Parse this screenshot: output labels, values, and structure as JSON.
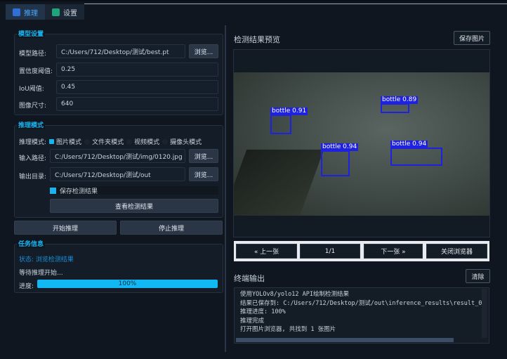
{
  "tabs": [
    {
      "label": "推理",
      "icon": "chart-icon"
    },
    {
      "label": "设置",
      "icon": "check-icon"
    }
  ],
  "model_settings": {
    "title": "模型设置",
    "path_label": "模型路径:",
    "path_value": "C:/Users/712/Desktop/测试/best.pt",
    "browse": "浏览...",
    "conf_label": "置信度阈值:",
    "conf_value": "0.25",
    "iou_label": "IoU阈值:",
    "iou_value": "0.45",
    "size_label": "图像尺寸:",
    "size_value": "640"
  },
  "inference_mode": {
    "title": "推理模式",
    "mode_label": "推理模式:",
    "modes": [
      "图片模式",
      "文件夹模式",
      "视频模式",
      "摄像头模式"
    ],
    "input_label": "输入路径:",
    "input_value": "C:/Users/712/Desktop/测试/img/0120.jpg",
    "output_label": "输出目录:",
    "output_value": "C:/Users/712/Desktop/测试/out",
    "browse": "浏览...",
    "save_checkbox": "保存检测结果",
    "view_results": "查看检测结果"
  },
  "actions": {
    "start": "开始推理",
    "stop": "停止推理"
  },
  "task_info": {
    "title": "任务信息",
    "status": "状态: 浏览检测结果",
    "message": "等待推理开始...",
    "progress_label": "进度:",
    "progress_text": "100%",
    "progress": 100
  },
  "preview": {
    "title": "检测结果预览",
    "save": "保存图片",
    "detections": [
      {
        "label": "bottle 0.91"
      },
      {
        "label": "bottle 0.89"
      },
      {
        "label": "bottle 0.94"
      },
      {
        "label": "bottle 0.94"
      }
    ],
    "prev": "« 上一张",
    "page": "1/1",
    "next": "下一张 »",
    "close": "关闭浏览器"
  },
  "terminal": {
    "title": "终端输出",
    "clear": "清除",
    "lines": [
      "使用YOLOv8/yolo12 API绘制检测结果",
      "结果已保存到: C:/Users/712/Desktop/测试/out\\inference_results\\result_0",
      "推理进度: 100%",
      "推理完成",
      "打开图片浏览器, 共找到 1 张图片"
    ]
  },
  "colors": {
    "accent": "#19b4f0",
    "box": "#1e22e0"
  }
}
